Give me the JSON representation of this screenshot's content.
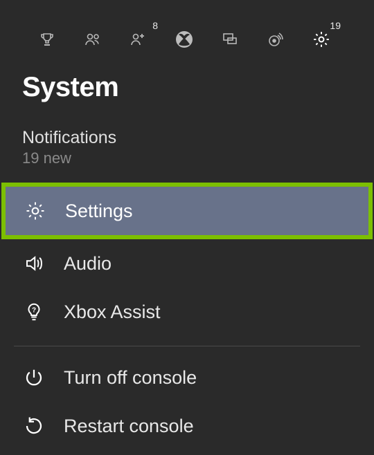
{
  "topnav": {
    "items": [
      {
        "name": "achievements-icon"
      },
      {
        "name": "friends-icon"
      },
      {
        "name": "party-icon",
        "badge": "8"
      },
      {
        "name": "xbox-icon"
      },
      {
        "name": "messages-icon"
      },
      {
        "name": "broadcast-icon"
      },
      {
        "name": "settings-icon",
        "badge": "19",
        "active": true
      }
    ]
  },
  "heading": "System",
  "notifications": {
    "title": "Notifications",
    "subtitle": "19 new"
  },
  "menu": {
    "settings_label": "Settings",
    "audio_label": "Audio",
    "assist_label": "Xbox Assist",
    "turnoff_label": "Turn off console",
    "restart_label": "Restart console"
  }
}
